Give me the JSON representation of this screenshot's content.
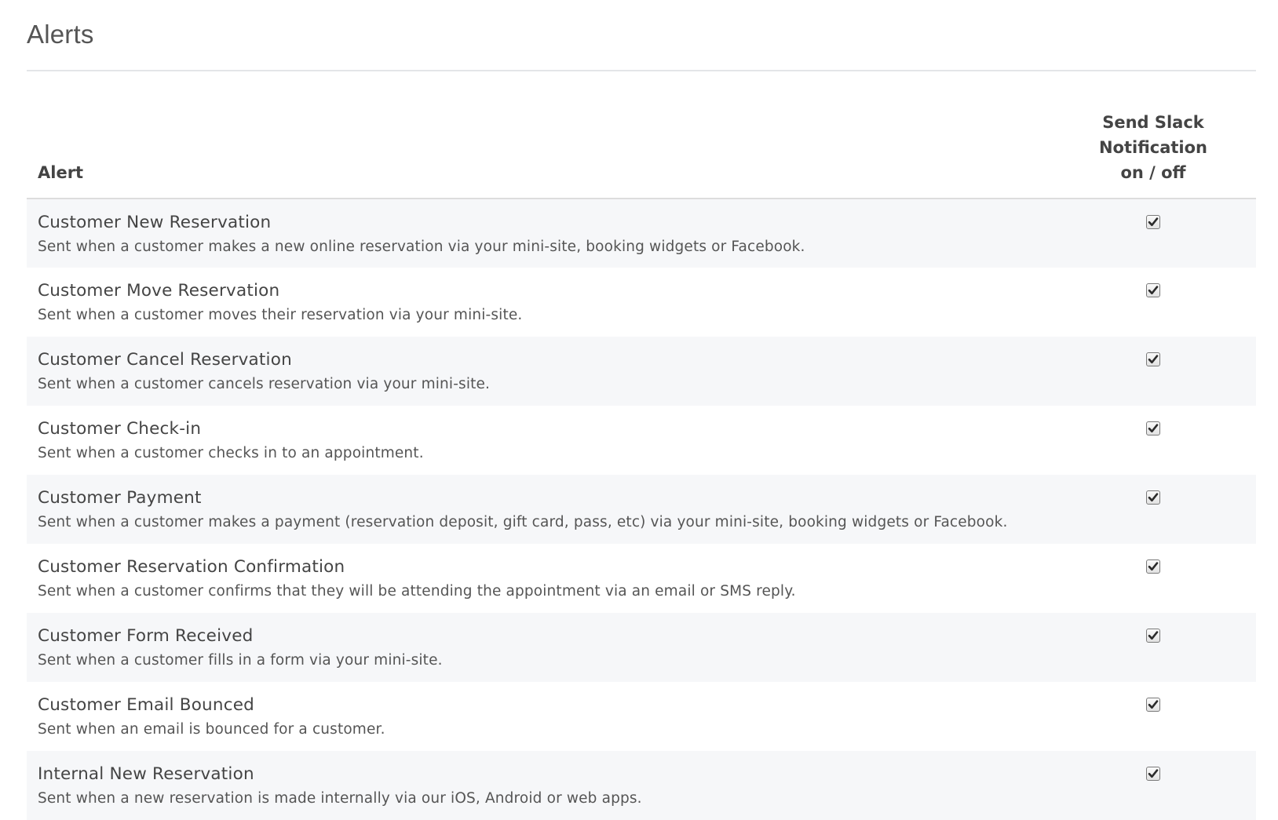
{
  "page_title": "Alerts",
  "table": {
    "headers": {
      "alert": "Alert",
      "slack_line1": "Send Slack Notification",
      "slack_line2": "on / off"
    },
    "rows": [
      {
        "name": "Customer New Reservation",
        "description": "Sent when a customer makes a new online reservation via your mini-site, booking widgets or Facebook.",
        "slack_enabled": true
      },
      {
        "name": "Customer Move Reservation",
        "description": "Sent when a customer moves their reservation via your mini-site.",
        "slack_enabled": true
      },
      {
        "name": "Customer Cancel Reservation",
        "description": "Sent when a customer cancels reservation via your mini-site.",
        "slack_enabled": true
      },
      {
        "name": "Customer Check-in",
        "description": "Sent when a customer checks in to an appointment.",
        "slack_enabled": true
      },
      {
        "name": "Customer Payment",
        "description": "Sent when a customer makes a payment (reservation deposit, gift card, pass, etc) via your mini-site, booking widgets or Facebook.",
        "slack_enabled": true
      },
      {
        "name": "Customer Reservation Confirmation",
        "description": "Sent when a customer confirms that they will be attending the appointment via an email or SMS reply.",
        "slack_enabled": true
      },
      {
        "name": "Customer Form Received",
        "description": "Sent when a customer fills in a form via your mini-site.",
        "slack_enabled": true
      },
      {
        "name": "Customer Email Bounced",
        "description": "Sent when an email is bounced for a customer.",
        "slack_enabled": true
      },
      {
        "name": "Internal New Reservation",
        "description": "Sent when a new reservation is made internally via our iOS, Android or web apps.",
        "slack_enabled": true
      }
    ]
  }
}
